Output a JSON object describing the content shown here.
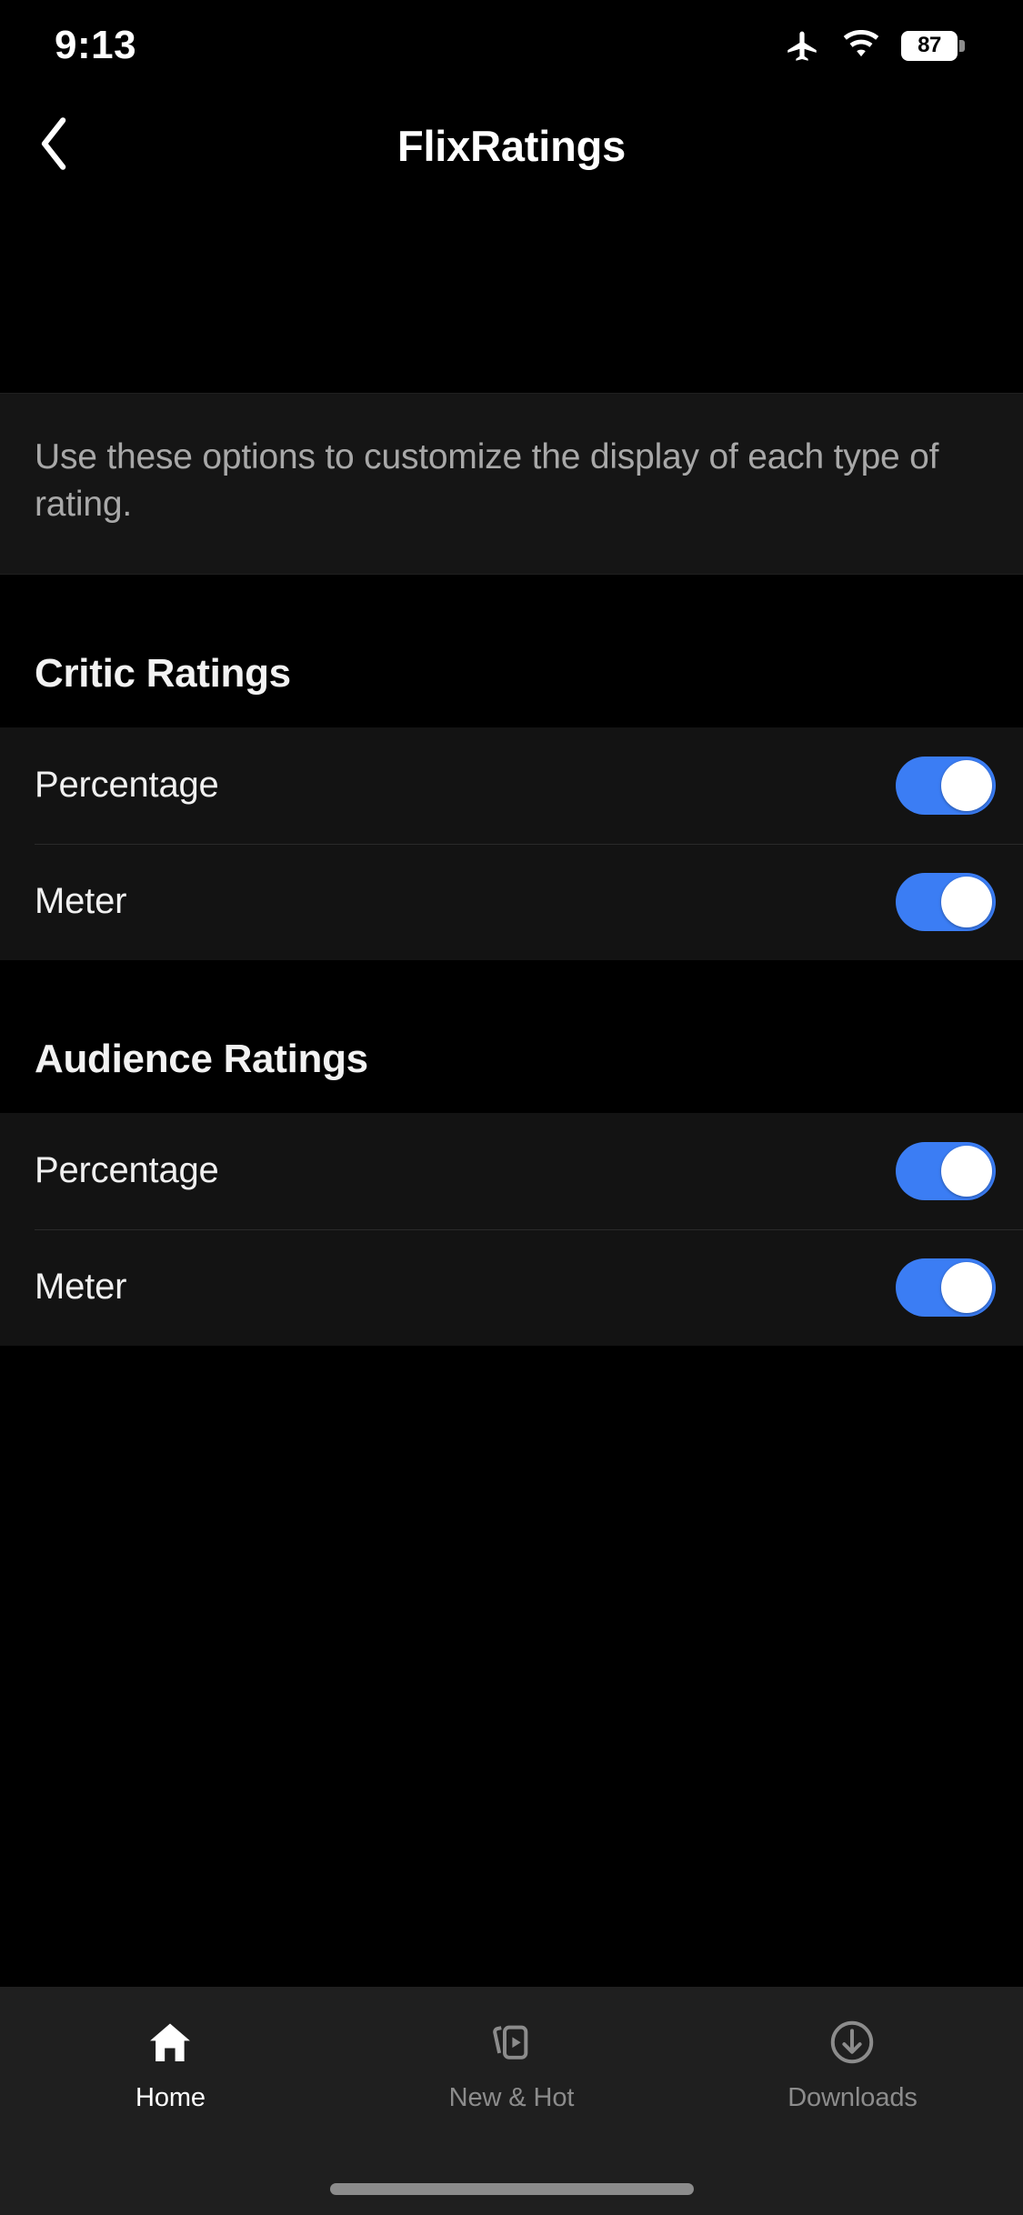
{
  "status_bar": {
    "time": "9:13",
    "airplane_icon": "airplane-mode-icon",
    "wifi_icon": "wifi-icon",
    "battery_level": "87"
  },
  "header": {
    "back_icon": "chevron-left-icon",
    "title": "FlixRatings"
  },
  "description": {
    "text": "Use these options to customize the display of each type of rating."
  },
  "sections": [
    {
      "title": "Critic Ratings",
      "rows": [
        {
          "label": "Percentage",
          "toggle_state": "on"
        },
        {
          "label": "Meter",
          "toggle_state": "on"
        }
      ]
    },
    {
      "title": "Audience Ratings",
      "rows": [
        {
          "label": "Percentage",
          "toggle_state": "on"
        },
        {
          "label": "Meter",
          "toggle_state": "on"
        }
      ]
    }
  ],
  "tabbar": {
    "items": [
      {
        "label": "Home",
        "icon": "home-icon",
        "active": true
      },
      {
        "label": "New & Hot",
        "icon": "new-and-hot-icon",
        "active": false
      },
      {
        "label": "Downloads",
        "icon": "download-circle-icon",
        "active": false
      }
    ]
  },
  "colors": {
    "accent": "#3b7df4",
    "background": "#000000",
    "panel": "#131313",
    "description_panel": "#151515",
    "tabbar": "#1f1f1f",
    "muted_text": "#8c8c8c"
  }
}
